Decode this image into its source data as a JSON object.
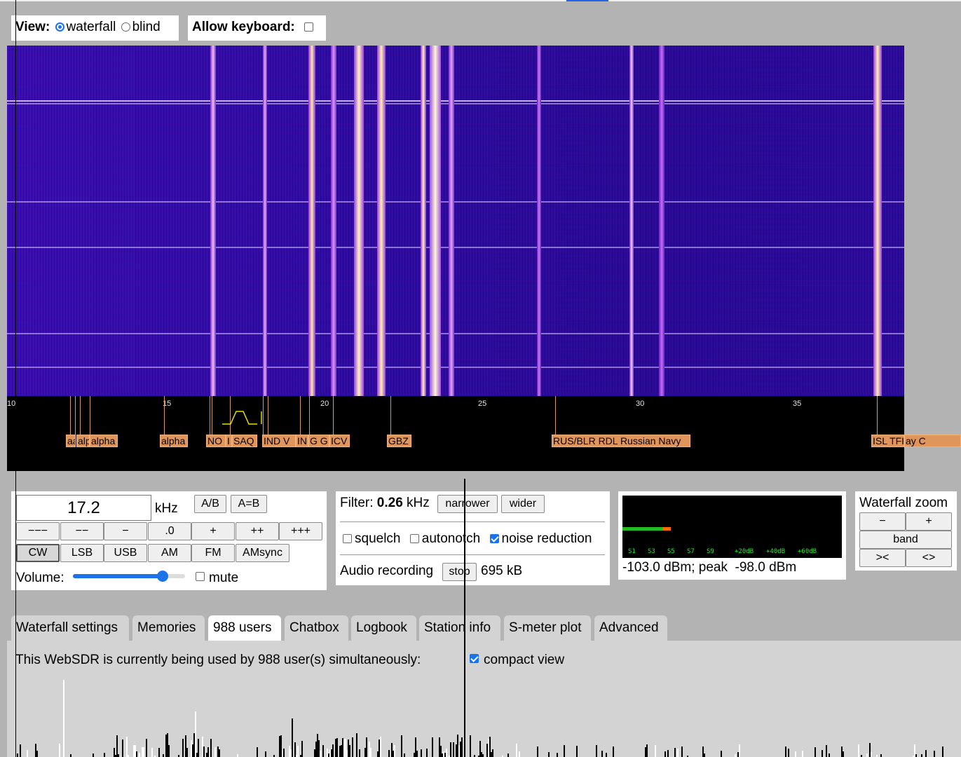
{
  "view_bar": {
    "view_label": "View:",
    "opt_waterfall": "waterfall",
    "opt_blind": "blind",
    "allow_keyboard_label": "Allow keyboard:"
  },
  "scale": {
    "ticks": [
      "10",
      "15",
      "20",
      "25",
      "30",
      "35"
    ],
    "stations": [
      {
        "text": "aa"
      },
      {
        "text": "alp"
      },
      {
        "text": "alpha"
      },
      {
        "text": "alpha"
      },
      {
        "text": "NO"
      },
      {
        "text": "I"
      },
      {
        "text": "SAQ"
      },
      {
        "text": "IND V"
      },
      {
        "text": "IN"
      },
      {
        "text": "G G"
      },
      {
        "text": "ICV"
      },
      {
        "text": "GBZ"
      },
      {
        "text": "RUS/BLR RDL Russian Navy"
      },
      {
        "text": "ISL TFK US Navy C"
      }
    ]
  },
  "tuning": {
    "frequency_value": "17.2",
    "unit": "kHz",
    "ab": "A/B",
    "aeqb": "A=B",
    "steps": [
      "−−−",
      "−−",
      "−",
      ".0",
      "+",
      "++",
      "+++"
    ],
    "modes": [
      "CW",
      "LSB",
      "USB",
      "AM",
      "FM",
      "AMsync"
    ],
    "active_mode": "CW",
    "volume_label": "Volume:",
    "volume_level": 0.8,
    "mute_label": "mute"
  },
  "filter": {
    "label": "Filter:",
    "value": "0.26",
    "unit": "kHz",
    "narrower": "narrower",
    "wider": "wider",
    "squelch": "squelch",
    "autonotch": "autonotch",
    "noise_reduction": "noise reduction",
    "recording_label": "Audio recording",
    "stop": "stop",
    "recording_size": "695 kB"
  },
  "smeter": {
    "scale_labels": [
      "S1",
      "S3",
      "S5",
      "S7",
      "S9",
      "+20dB",
      "+40dB",
      "+60dB"
    ],
    "reading": "-103.0 dBm; peak  -98.0 dBm",
    "level_fraction": 0.22,
    "colors": {
      "bar": "#22bb22",
      "peak": "#ff6a00",
      "labels": "#22ee22"
    }
  },
  "zoom": {
    "title": "Waterfall zoom",
    "minus": "−",
    "plus": "+",
    "band": "band",
    "zoom_in": "><",
    "zoom_out": "<>"
  },
  "tabs": [
    "Waterfall settings",
    "Memories",
    "988 users",
    "Chatbox",
    "Logbook",
    "Station info",
    "S-meter plot",
    "Advanced"
  ],
  "active_tab": "988 users",
  "users_panel": {
    "text": "This WebSDR is currently being used by 988 user(s) simultaneously:",
    "compact_view": "compact view"
  }
}
